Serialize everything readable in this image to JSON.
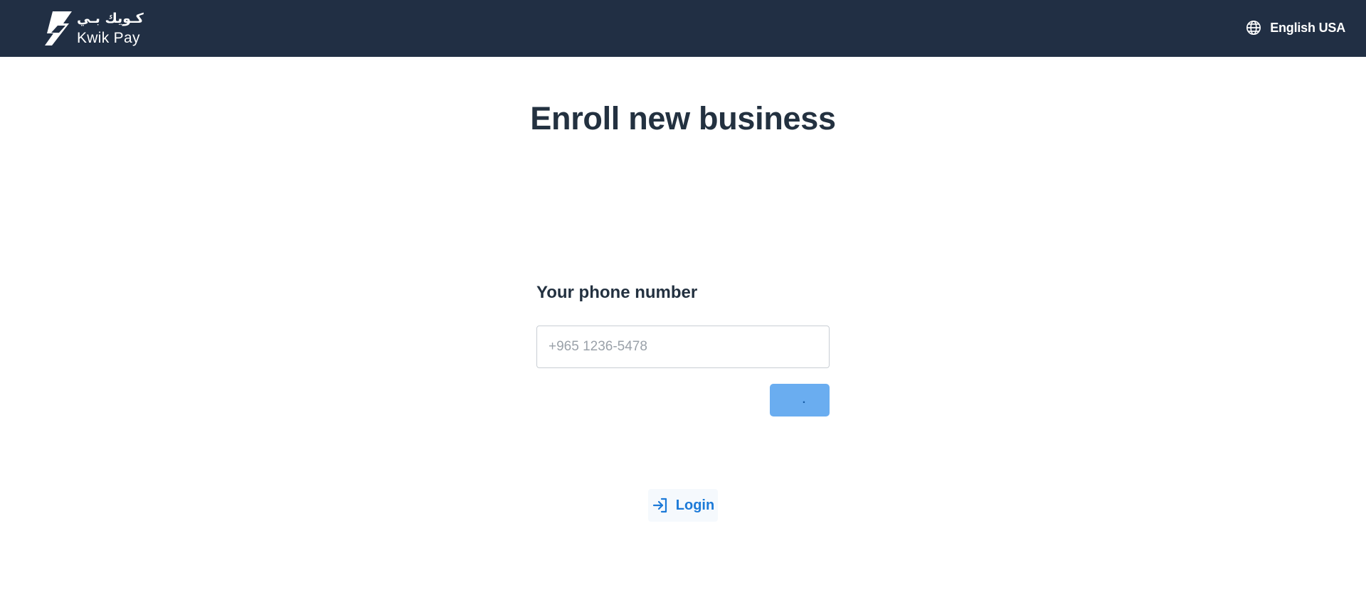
{
  "header": {
    "brand_arabic": "كـويك بـي",
    "brand_english": "Kwik Pay",
    "language_icon": "globe-icon",
    "language_label": "English USA"
  },
  "main": {
    "title": "Enroll new business",
    "phone_field": {
      "label": "Your phone number",
      "placeholder": "+965 1236-5478",
      "value": ""
    },
    "submit_button_label": "."
  },
  "footer_actions": {
    "login_icon": "login-arrow-icon",
    "login_label": "Login"
  },
  "colors": {
    "header_background": "#212f44",
    "title_text": "#233140",
    "button_background": "#6aadf0",
    "link_text": "#1c7ad8"
  }
}
